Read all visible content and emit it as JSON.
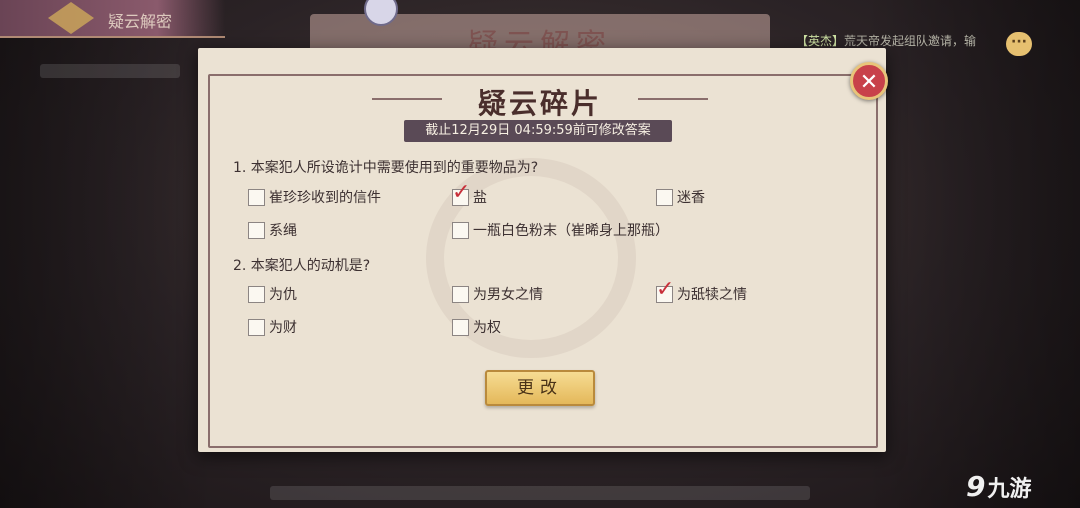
{
  "background": {
    "top_tab_label": "疑云解密",
    "banner_text": "疑云解密",
    "chat_tag": "【英杰】",
    "chat_message": "荒天帝发起组队邀请，输",
    "chat_icon": "speech-bubble-icon"
  },
  "dialog": {
    "title": "疑云碎片",
    "deadline": "截止12月29日 04:59:59前可修改答案",
    "close_icon": "close-icon",
    "questions": [
      {
        "text": "1. 本案犯人所设诡计中需要使用到的重要物品为?",
        "options": [
          {
            "label": "崔珍珍收到的信件",
            "checked": false
          },
          {
            "label": "盐",
            "checked": true
          },
          {
            "label": "迷香",
            "checked": false
          },
          {
            "label": "系绳",
            "checked": false
          },
          {
            "label": "一瓶白色粉末（崔晞身上那瓶）",
            "checked": false
          }
        ]
      },
      {
        "text": "2. 本案犯人的动机是?",
        "options": [
          {
            "label": "为仇",
            "checked": false
          },
          {
            "label": "为男女之情",
            "checked": false
          },
          {
            "label": "为舐犊之情",
            "checked": true
          },
          {
            "label": "为财",
            "checked": false
          },
          {
            "label": "为权",
            "checked": false
          }
        ]
      }
    ],
    "change_button": "更改"
  },
  "watermark_logo": {
    "text": "九游"
  },
  "colors": {
    "panel": "#ebe2d3",
    "accent_red": "#c8303a",
    "button_gold": "#e4b85a",
    "deadline_bar": "#5a4a56"
  }
}
